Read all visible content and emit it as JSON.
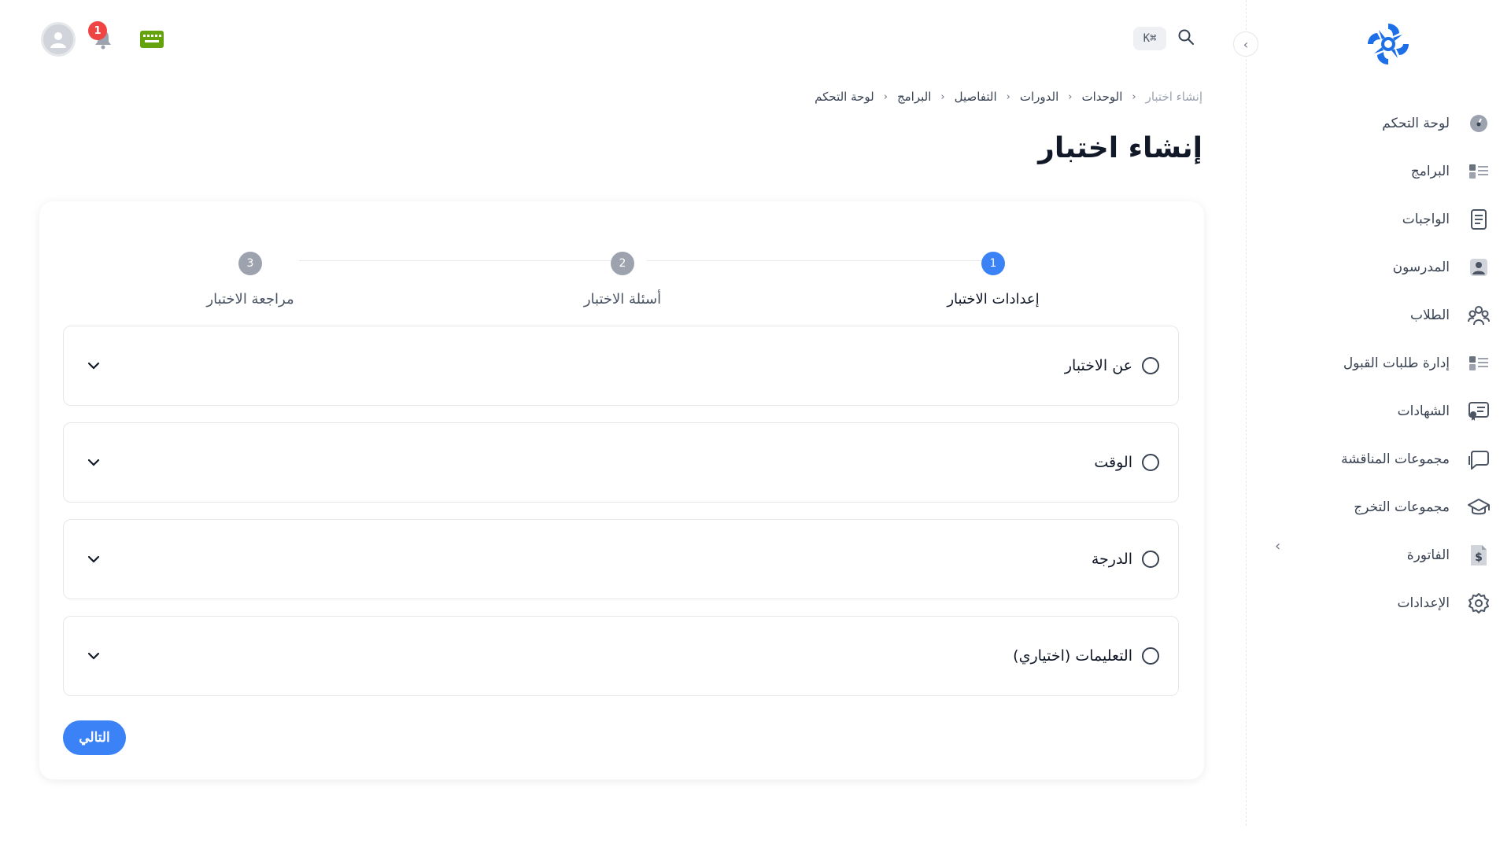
{
  "sidebar": {
    "items": [
      {
        "label": "لوحة التحكم",
        "icon": "dashboard-icon"
      },
      {
        "label": "البرامج",
        "icon": "programs-icon"
      },
      {
        "label": "الواجبات",
        "icon": "assignments-icon"
      },
      {
        "label": "المدرسون",
        "icon": "teachers-icon"
      },
      {
        "label": "الطلاب",
        "icon": "students-icon"
      },
      {
        "label": "إدارة طلبات القبول",
        "icon": "admissions-icon"
      },
      {
        "label": "الشهادات",
        "icon": "certificates-icon"
      },
      {
        "label": "مجموعات المناقشة",
        "icon": "discussion-icon"
      },
      {
        "label": "مجموعات التخرج",
        "icon": "graduation-icon"
      },
      {
        "label": "الفاتورة",
        "icon": "invoice-icon"
      },
      {
        "label": "الإعدادات",
        "icon": "settings-icon"
      }
    ]
  },
  "header": {
    "shortcut": "K⌘",
    "notification_count": "1"
  },
  "breadcrumb": [
    "لوحة التحكم",
    "البرامج",
    "التفاصيل",
    "الدورات",
    "الوحدات",
    "إنشاء اختبار"
  ],
  "page_title": "إنشاء اختبار",
  "stepper": {
    "steps": [
      {
        "number": "1",
        "label": "إعدادات الاختبار",
        "state": "active"
      },
      {
        "number": "2",
        "label": "أسئلة الاختبار",
        "state": "pending"
      },
      {
        "number": "3",
        "label": "مراجعة الاختبار",
        "state": "pending"
      }
    ]
  },
  "sections": [
    {
      "title": "عن الاختبار"
    },
    {
      "title": "الوقت"
    },
    {
      "title": "الدرجة"
    },
    {
      "title": "التعليمات (اختياري)"
    }
  ],
  "next_label": "التالي",
  "colors": {
    "accent": "#3b82f6",
    "pending": "#9ca3af",
    "badge": "#ef4444",
    "keyboard": "#65a30d"
  }
}
